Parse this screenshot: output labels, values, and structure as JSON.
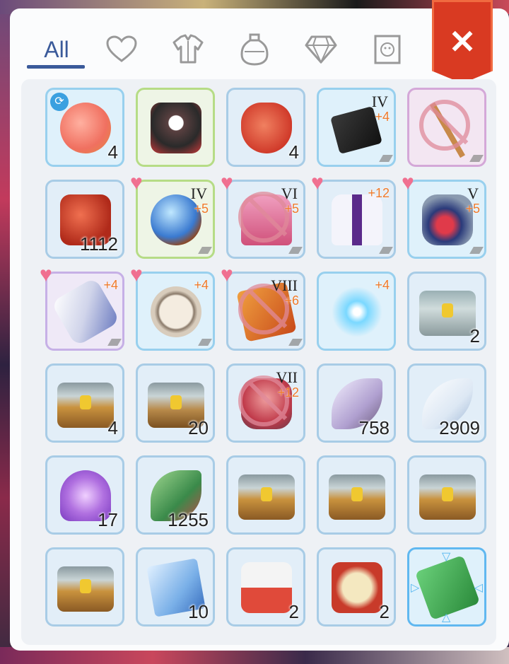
{
  "tabs": {
    "all_label": "All",
    "icons": [
      "heart-icon",
      "armor-icon",
      "potion-icon",
      "gem-icon",
      "card-icon"
    ]
  },
  "close_label": "✕",
  "colors": {
    "accent": "#3a5a9a",
    "close": "#d93a22",
    "refine": "#f07a2a",
    "heart": "#f07090"
  },
  "items": [
    {
      "name": "fruit",
      "count": "4"
    },
    {
      "name": "boar-pet",
      "count": ""
    },
    {
      "name": "heart-organ",
      "count": "4"
    },
    {
      "name": "black-book",
      "rank": "IV",
      "refine": "+4"
    },
    {
      "name": "staff",
      "count": ""
    },
    {
      "name": "red-crystals",
      "count": "1112"
    },
    {
      "name": "crystal-orb",
      "rank": "IV",
      "refine": "+5"
    },
    {
      "name": "pink-robe",
      "rank": "VI",
      "refine": "+5"
    },
    {
      "name": "white-cape",
      "refine": "+12"
    },
    {
      "name": "boots",
      "rank": "V",
      "refine": "+5"
    },
    {
      "name": "gloves",
      "refine": "+4"
    },
    {
      "name": "pocket-watch",
      "refine": "+4"
    },
    {
      "name": "orange-book",
      "rank": "VIII",
      "refine": "+6"
    },
    {
      "name": "angel-wings",
      "refine": "+4"
    },
    {
      "name": "silver-chest",
      "count": "2"
    },
    {
      "name": "gold-chest",
      "count": "4"
    },
    {
      "name": "silver-chest",
      "count": "20"
    },
    {
      "name": "red-armor",
      "rank": "VII",
      "refine": "+12"
    },
    {
      "name": "moth-wing",
      "count": "758"
    },
    {
      "name": "white-feather",
      "count": "2909"
    },
    {
      "name": "purple-wings",
      "count": "17"
    },
    {
      "name": "green-leaf",
      "count": "1255"
    },
    {
      "name": "gold-chest",
      "count": ""
    },
    {
      "name": "gold-chest",
      "count": ""
    },
    {
      "name": "gold-chest",
      "count": ""
    },
    {
      "name": "gold-chest",
      "count": ""
    },
    {
      "name": "blue-card",
      "count": "10"
    },
    {
      "name": "medkit",
      "count": "2"
    },
    {
      "name": "food-box",
      "count": "2"
    },
    {
      "name": "green-book",
      "count": ""
    }
  ]
}
